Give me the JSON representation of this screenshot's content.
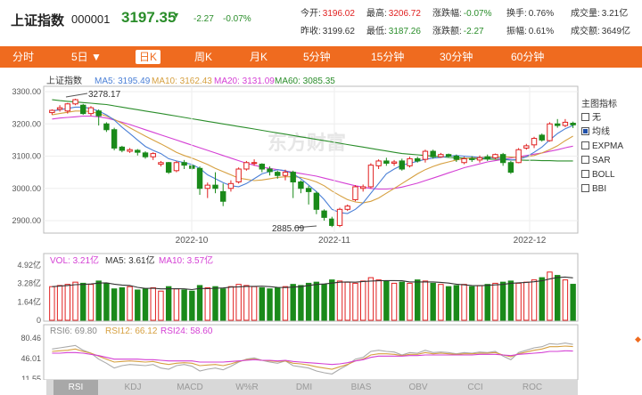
{
  "header": {
    "name": "上证指数",
    "code": "000001",
    "price": "3197.35",
    "arrow": "▼",
    "change": "-2.27",
    "change_pct": "-0.07%",
    "stats": [
      {
        "label": "今开:",
        "value": "3196.02",
        "color": "red"
      },
      {
        "label": "最高:",
        "value": "3206.72",
        "color": "red"
      },
      {
        "label": "涨跌幅:",
        "value": "-0.07%",
        "color": "grn"
      },
      {
        "label": "换手:",
        "value": "0.76%",
        "color": "blk"
      },
      {
        "label": "成交量:",
        "value": "3.21亿",
        "color": "blk"
      },
      {
        "label": "昨收:",
        "value": "3199.62",
        "color": "blk"
      },
      {
        "label": "最低:",
        "value": "3187.26",
        "color": "grn"
      },
      {
        "label": "涨跌额:",
        "value": "-2.27",
        "color": "grn"
      },
      {
        "label": "振幅:",
        "value": "0.61%",
        "color": "blk"
      },
      {
        "label": "成交额:",
        "value": "3649亿",
        "color": "blk"
      }
    ]
  },
  "tabs": [
    "分时",
    "5日 ▼",
    "日K",
    "周K",
    "月K",
    "5分钟",
    "15分钟",
    "30分钟",
    "60分钟"
  ],
  "active_tab": "日K",
  "main_legend": {
    "title": "上证指数",
    "ma5": "MA5: 3195.49",
    "ma10": "MA10: 3162.43",
    "ma20": "MA20: 3131.09",
    "ma60": "MA60: 3085.35"
  },
  "y_axis": [
    "3300.00",
    "3200.00",
    "3100.00",
    "3000.00",
    "2900.00"
  ],
  "x_axis": [
    "2022-10",
    "2022-11",
    "2022-12"
  ],
  "annotations": {
    "high": "3278.17",
    "low": "2885.09"
  },
  "watermark": "东方财富",
  "volume_legend": {
    "vol": "VOL: 3.21亿",
    "ma5": "MA5: 3.61亿",
    "ma10": "MA10: 3.57亿"
  },
  "volume_axis": [
    "4.92亿",
    "3.28亿",
    "1.64亿",
    "0"
  ],
  "rsi_legend": {
    "rsi6": "RSI6: 69.80",
    "rsi12": "RSI12: 66.12",
    "rsi24": "RSI24: 58.60"
  },
  "rsi_axis": [
    "80.46",
    "46.01",
    "11.55"
  ],
  "side_panel": {
    "title": "主图指标",
    "options": [
      {
        "label": "无",
        "checked": false
      },
      {
        "label": "均线",
        "checked": true
      },
      {
        "label": "EXPMA",
        "checked": false
      },
      {
        "label": "SAR",
        "checked": false
      },
      {
        "label": "BOLL",
        "checked": false
      },
      {
        "label": "BBI",
        "checked": false
      }
    ]
  },
  "indicator_tabs": [
    "RSI",
    "KDJ",
    "MACD",
    "W%R",
    "DMI",
    "BIAS",
    "OBV",
    "CCI",
    "ROC"
  ],
  "active_indicator": "RSI",
  "colors": {
    "up": "#e02020",
    "down": "#1a8a1a",
    "ma5": "#4a7fd6",
    "ma10": "#d6a040",
    "ma20": "#d43fd4",
    "ma60": "#2a8d2a",
    "accent": "#ef6b1f"
  },
  "chart_data": {
    "type": "candlestick",
    "title": "上证指数",
    "ylim": [
      2860,
      3320
    ],
    "candles": [
      [
        3235,
        3242,
        3228,
        3245
      ],
      [
        3245,
        3250,
        3238,
        3258
      ],
      [
        3240,
        3262,
        3232,
        3265
      ],
      [
        3262,
        3275,
        3258,
        3278
      ],
      [
        3258,
        3232,
        3228,
        3262
      ],
      [
        3232,
        3250,
        3225,
        3255
      ],
      [
        3240,
        3225,
        3195,
        3245
      ],
      [
        3200,
        3182,
        3175,
        3205
      ],
      [
        3182,
        3125,
        3118,
        3188
      ],
      [
        3128,
        3118,
        3112,
        3132
      ],
      [
        3115,
        3120,
        3110,
        3125
      ],
      [
        3118,
        3112,
        3102,
        3122
      ],
      [
        3110,
        3098,
        3092,
        3115
      ],
      [
        3098,
        3108,
        3088,
        3112
      ],
      [
        3075,
        3080,
        3068,
        3085
      ],
      [
        3080,
        3050,
        3045,
        3082
      ],
      [
        3055,
        3080,
        3050,
        3085
      ],
      [
        3080,
        3072,
        3060,
        3088
      ],
      [
        3070,
        3062,
        3058,
        3075
      ],
      [
        3062,
        3000,
        2980,
        3068
      ],
      [
        3000,
        3010,
        2970,
        3018
      ],
      [
        3010,
        3000,
        2985,
        3050
      ],
      [
        2990,
        2960,
        2945,
        3015
      ],
      [
        3000,
        3015,
        2990,
        3025
      ],
      [
        3020,
        3060,
        3015,
        3065
      ],
      [
        3060,
        3080,
        3055,
        3085
      ],
      [
        3080,
        3080,
        3070,
        3090
      ],
      [
        3075,
        3060,
        3050,
        3078
      ],
      [
        3060,
        3052,
        3040,
        3068
      ],
      [
        3050,
        3040,
        3030,
        3055
      ],
      [
        3040,
        3050,
        3025,
        3058
      ],
      [
        3050,
        3020,
        2970,
        3055
      ],
      [
        3020,
        3000,
        2985,
        3025
      ],
      [
        3000,
        2990,
        2950,
        3008
      ],
      [
        2985,
        2935,
        2920,
        2990
      ],
      [
        2930,
        2910,
        2900,
        2935
      ],
      [
        2905,
        2885,
        2880,
        2912
      ],
      [
        2885,
        2935,
        2880,
        2940
      ],
      [
        2935,
        2945,
        2930,
        2950
      ],
      [
        2965,
        3005,
        2960,
        3010
      ],
      [
        3000,
        3005,
        2990,
        3012
      ],
      [
        3005,
        3072,
        3000,
        3078
      ],
      [
        3070,
        3085,
        3060,
        3090
      ],
      [
        3085,
        3078,
        3070,
        3095
      ],
      [
        3078,
        3082,
        3070,
        3088
      ],
      [
        3085,
        3060,
        3055,
        3092
      ],
      [
        3070,
        3092,
        3065,
        3098
      ],
      [
        3092,
        3085,
        3080,
        3098
      ],
      [
        3090,
        3115,
        3080,
        3120
      ],
      [
        3115,
        3098,
        3092,
        3120
      ],
      [
        3098,
        3105,
        3095,
        3110
      ],
      [
        3105,
        3100,
        3095,
        3108
      ],
      [
        3100,
        3090,
        3082,
        3105
      ],
      [
        3080,
        3092,
        3075,
        3098
      ],
      [
        3092,
        3090,
        3082,
        3100
      ],
      [
        3088,
        3095,
        3080,
        3102
      ],
      [
        3098,
        3092,
        3085,
        3105
      ],
      [
        3095,
        3105,
        3090,
        3108
      ],
      [
        3105,
        3080,
        3070,
        3110
      ],
      [
        3080,
        3050,
        3045,
        3085
      ],
      [
        3080,
        3120,
        3078,
        3125
      ],
      [
        3125,
        3132,
        3120,
        3138
      ],
      [
        3135,
        3155,
        3125,
        3160
      ],
      [
        3165,
        3150,
        3145,
        3170
      ],
      [
        3148,
        3200,
        3145,
        3205
      ],
      [
        3200,
        3195,
        3188,
        3215
      ],
      [
        3195,
        3205,
        3190,
        3215
      ],
      [
        3202,
        3197,
        3187,
        3207
      ]
    ],
    "ma5": [
      3240,
      3244,
      3248,
      3252,
      3252,
      3248,
      3240,
      3228,
      3212,
      3190,
      3170,
      3150,
      3130,
      3118,
      3108,
      3092,
      3085,
      3080,
      3074,
      3062,
      3042,
      3030,
      3018,
      3008,
      3005,
      3015,
      3030,
      3045,
      3052,
      3058,
      3055,
      3045,
      3030,
      3010,
      2990,
      2965,
      2935,
      2925,
      2922,
      2935,
      2955,
      2985,
      3015,
      3045,
      3060,
      3072,
      3078,
      3084,
      3090,
      3094,
      3096,
      3100,
      3102,
      3100,
      3098,
      3096,
      3094,
      3096,
      3092,
      3088,
      3090,
      3098,
      3112,
      3128,
      3150,
      3170,
      3185,
      3195
    ],
    "ma10": [
      3228,
      3232,
      3236,
      3240,
      3240,
      3238,
      3232,
      3224,
      3214,
      3202,
      3188,
      3175,
      3162,
      3150,
      3138,
      3125,
      3112,
      3102,
      3094,
      3084,
      3074,
      3062,
      3052,
      3042,
      3032,
      3028,
      3024,
      3026,
      3030,
      3034,
      3036,
      3036,
      3034,
      3028,
      3020,
      3008,
      2992,
      2978,
      2965,
      2958,
      2955,
      2960,
      2970,
      2985,
      3000,
      3015,
      3030,
      3045,
      3058,
      3068,
      3076,
      3082,
      3088,
      3092,
      3095,
      3096,
      3097,
      3098,
      3098,
      3097,
      3096,
      3098,
      3102,
      3110,
      3120,
      3132,
      3148,
      3162
    ],
    "ma20": [
      3215,
      3218,
      3220,
      3222,
      3224,
      3224,
      3222,
      3218,
      3212,
      3205,
      3198,
      3190,
      3182,
      3174,
      3166,
      3158,
      3150,
      3142,
      3134,
      3126,
      3118,
      3110,
      3102,
      3094,
      3086,
      3078,
      3072,
      3066,
      3062,
      3058,
      3054,
      3050,
      3046,
      3042,
      3038,
      3032,
      3026,
      3020,
      3014,
      3008,
      3004,
      3000,
      2998,
      2998,
      3000,
      3004,
      3010,
      3016,
      3024,
      3032,
      3040,
      3048,
      3056,
      3064,
      3070,
      3076,
      3082,
      3086,
      3090,
      3094,
      3098,
      3102,
      3106,
      3110,
      3115,
      3120,
      3126,
      3131
    ],
    "ma60": [
      3275,
      3272,
      3270,
      3268,
      3266,
      3264,
      3262,
      3260,
      3256,
      3252,
      3248,
      3244,
      3240,
      3236,
      3232,
      3228,
      3224,
      3220,
      3216,
      3212,
      3208,
      3204,
      3200,
      3196,
      3192,
      3188,
      3184,
      3180,
      3176,
      3172,
      3168,
      3164,
      3160,
      3156,
      3152,
      3148,
      3144,
      3140,
      3136,
      3132,
      3128,
      3124,
      3120,
      3116,
      3112,
      3108,
      3106,
      3104,
      3102,
      3100,
      3098,
      3096,
      3095,
      3094,
      3093,
      3092,
      3091,
      3090,
      3089,
      3088,
      3088,
      3087,
      3087,
      3086,
      3086,
      3085,
      3085,
      3085
    ],
    "volume": [
      3.0,
      3.1,
      3.2,
      3.4,
      3.3,
      3.2,
      3.5,
      3.3,
      2.8,
      2.9,
      3.0,
      2.7,
      2.8,
      2.9,
      2.6,
      3.0,
      2.8,
      2.7,
      2.6,
      3.1,
      2.9,
      3.0,
      2.8,
      3.0,
      3.2,
      3.1,
      3.0,
      2.9,
      2.8,
      2.9,
      3.0,
      3.2,
      3.1,
      3.3,
      3.4,
      3.2,
      3.6,
      3.5,
      3.4,
      3.3,
      3.5,
      3.8,
      3.6,
      3.5,
      3.3,
      3.4,
      3.3,
      3.6,
      3.5,
      3.3,
      3.2,
      3.0,
      3.1,
      3.2,
      3.0,
      3.1,
      3.2,
      3.3,
      3.4,
      3.5,
      3.3,
      3.4,
      3.6,
      3.8,
      4.3,
      4.0,
      3.6,
      3.21
    ],
    "rsi6": [
      62,
      64,
      66,
      68,
      60,
      55,
      45,
      38,
      30,
      34,
      36,
      35,
      34,
      36,
      30,
      28,
      34,
      36,
      33,
      25,
      28,
      30,
      27,
      33,
      40,
      45,
      47,
      43,
      40,
      38,
      42,
      34,
      32,
      30,
      25,
      22,
      20,
      28,
      35,
      45,
      48,
      58,
      60,
      58,
      57,
      52,
      56,
      55,
      60,
      56,
      57,
      56,
      54,
      56,
      55,
      57,
      56,
      58,
      50,
      44,
      56,
      60,
      64,
      66,
      71,
      70,
      72,
      69.8
    ],
    "rsi12": [
      58,
      59,
      60,
      62,
      58,
      55,
      50,
      45,
      40,
      41,
      42,
      41,
      40,
      41,
      38,
      36,
      38,
      39,
      38,
      34,
      35,
      36,
      34,
      37,
      41,
      44,
      45,
      43,
      42,
      41,
      42,
      38,
      37,
      35,
      32,
      30,
      28,
      32,
      36,
      42,
      45,
      52,
      54,
      54,
      53,
      51,
      53,
      53,
      56,
      54,
      55,
      54,
      53,
      54,
      54,
      55,
      55,
      56,
      52,
      49,
      54,
      57,
      60,
      62,
      66,
      66,
      67,
      66.12
    ],
    "rsi24": [
      55,
      55,
      56,
      56,
      55,
      53,
      51,
      48,
      45,
      45,
      45,
      45,
      44,
      44,
      43,
      42,
      42,
      42,
      42,
      40,
      40,
      40,
      40,
      41,
      42,
      43,
      44,
      43,
      43,
      42,
      43,
      41,
      40,
      39,
      38,
      37,
      36,
      37,
      39,
      42,
      44,
      48,
      50,
      50,
      50,
      50,
      51,
      51,
      52,
      52,
      52,
      52,
      52,
      52,
      52,
      53,
      53,
      53,
      52,
      51,
      53,
      54,
      55,
      56,
      58,
      58,
      59,
      58.6
    ],
    "rsi_ylim": [
      11.55,
      80.46
    ],
    "volume_ylim": [
      0,
      4.92
    ]
  }
}
